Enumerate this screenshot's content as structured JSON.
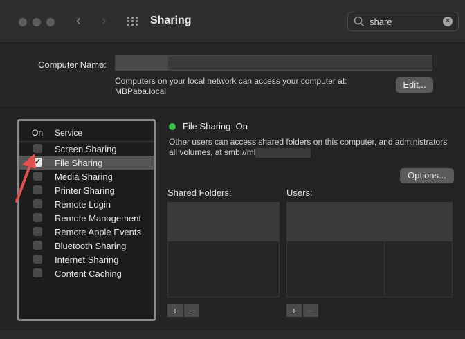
{
  "window": {
    "title": "Sharing"
  },
  "search": {
    "value": "share"
  },
  "computer": {
    "label": "Computer Name:",
    "info_line1": "Computers on your local network can access your computer at:",
    "info_line2": "MBPaba.local",
    "edit_label": "Edit..."
  },
  "services": {
    "col_on": "On",
    "col_service": "Service",
    "items": [
      {
        "label": "Screen Sharing",
        "checked": false
      },
      {
        "label": "File Sharing",
        "checked": true,
        "selected": true
      },
      {
        "label": "Media Sharing",
        "checked": false
      },
      {
        "label": "Printer Sharing",
        "checked": false
      },
      {
        "label": "Remote Login",
        "checked": false
      },
      {
        "label": "Remote Management",
        "checked": false
      },
      {
        "label": "Remote Apple Events",
        "checked": false
      },
      {
        "label": "Bluetooth Sharing",
        "checked": false
      },
      {
        "label": "Internet Sharing",
        "checked": false
      },
      {
        "label": "Content Caching",
        "checked": false
      }
    ]
  },
  "detail": {
    "status": "File Sharing: On",
    "status_color": "#3cc24a",
    "desc_line1": "Other users can access shared folders on this computer, and administrators",
    "desc_line2": "all volumes, at smb://ml",
    "options_label": "Options...",
    "shared_folders_label": "Shared Folders:",
    "users_label": "Users:",
    "add": "+",
    "remove": "−"
  },
  "icons": {
    "checkmark": "✓",
    "clear": "×",
    "back": "‹",
    "forward": "›"
  }
}
